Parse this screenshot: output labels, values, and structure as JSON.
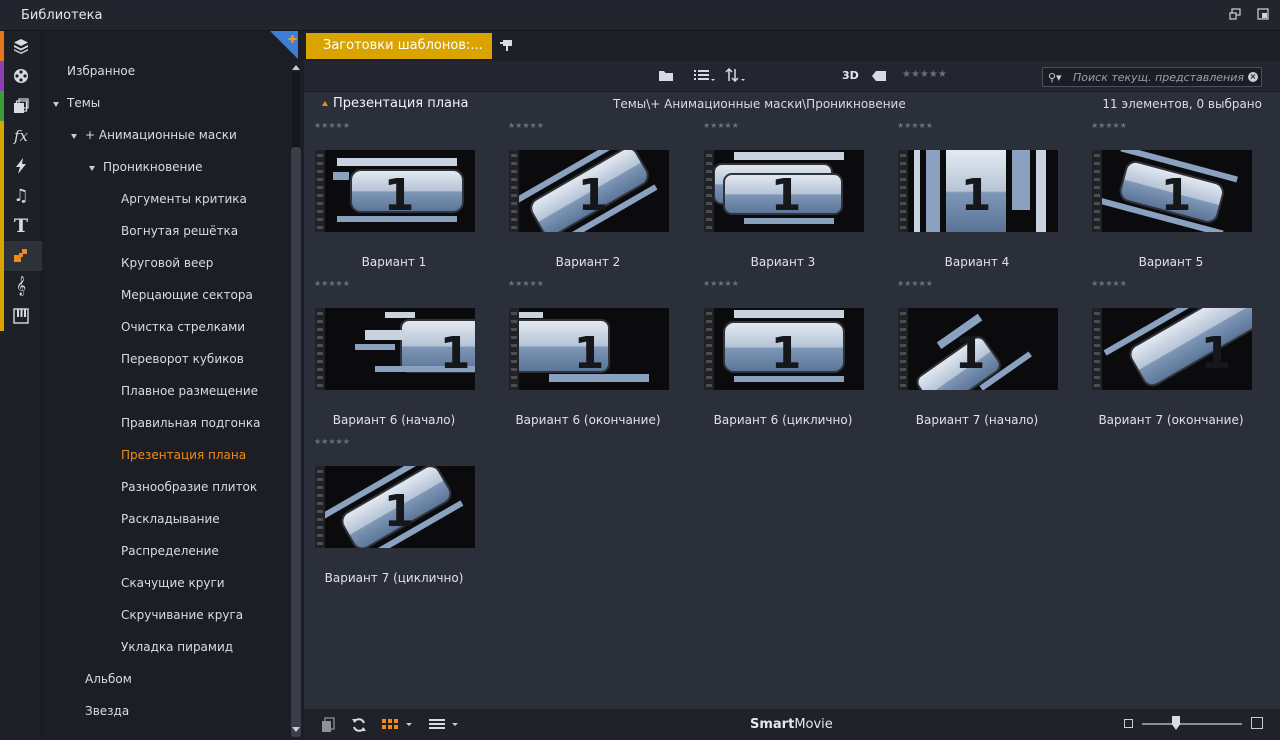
{
  "window": {
    "title": "Библиотека"
  },
  "tabs": {
    "active_label": "Заготовки шаблонов:..."
  },
  "toolbar": {
    "view_3d": "3D",
    "rating_filter": "★★★★★",
    "search_placeholder": "Поиск текущ. представления"
  },
  "pathbar": {
    "title": "Презентация плана",
    "breadcrumb": "Темы\\+ Анимационные маски\\Проникновение",
    "count": "11 элементов, 0 выбрано"
  },
  "tree": {
    "favorites": "Избранное",
    "themes": "Темы",
    "masks": "+ Анимационные маски",
    "penetration": "Проникновение",
    "leaves": [
      "Аргументы критика",
      "Вогнутая решётка",
      "Круговой веер",
      "Мерцающие сектора",
      "Очистка стрелками",
      "Переворот кубиков",
      "Плавное размещение",
      "Правильная подгонка",
      "Презентация плана",
      "Разнообразие плиток",
      "Раскладывание",
      "Распределение",
      "Скачущие круги",
      "Скручивание круга",
      "Укладка пирамид"
    ],
    "album": "Альбом",
    "star": "Звезда"
  },
  "items": [
    {
      "caption": "Вариант 1",
      "stars": "★★★★★"
    },
    {
      "caption": "Вариант 2",
      "stars": "★★★★★"
    },
    {
      "caption": "Вариант 3",
      "stars": "★★★★★"
    },
    {
      "caption": "Вариант 4",
      "stars": "★★★★★"
    },
    {
      "caption": "Вариант 5",
      "stars": "★★★★★"
    },
    {
      "caption": "Вариант 6 (начало)",
      "stars": "★★★★★"
    },
    {
      "caption": "Вариант 6 (окончание)",
      "stars": "★★★★★"
    },
    {
      "caption": "Вариант 6 (циклично)",
      "stars": "★★★★★"
    },
    {
      "caption": "Вариант 7 (начало)",
      "stars": "★★★★★"
    },
    {
      "caption": "Вариант 7 (окончание)",
      "stars": "★★★★★"
    },
    {
      "caption": "Вариант 7 (циклично)",
      "stars": "★★★★★"
    }
  ],
  "thumb_digit": "1",
  "bottombar": {
    "brand_bold": "Smart",
    "brand_rest": "Movie"
  },
  "colors": {
    "accent_orange": "#f08a1c",
    "tab_yellow": "#d9a400",
    "flag_blue": "#3e7fd3"
  },
  "icons": {
    "strip": [
      "package-icon",
      "film-reel-icon",
      "photos-icon",
      "fx-icon",
      "lightning-icon",
      "music-note-icon",
      "title-icon",
      "theme-icon",
      "treble-clef-icon",
      "piano-icon"
    ]
  }
}
